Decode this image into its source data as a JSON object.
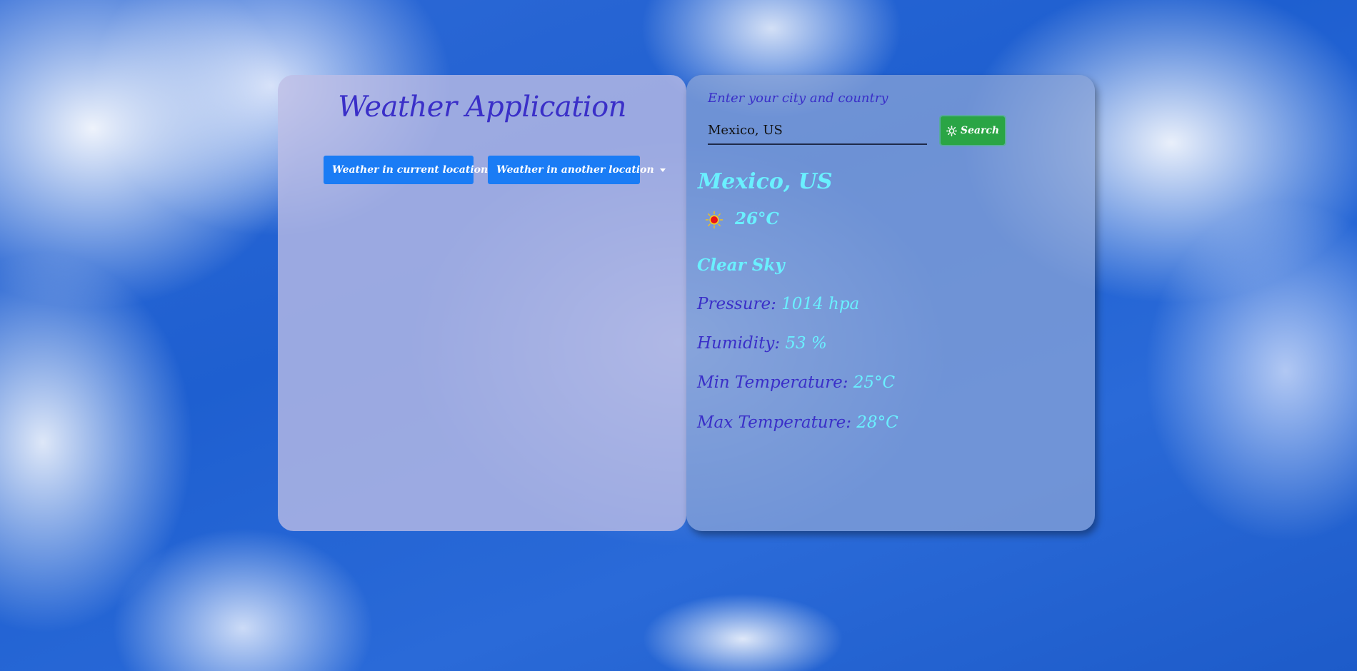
{
  "app": {
    "title": "Weather Application"
  },
  "location_menu": {
    "current_label": "Weather in current location",
    "another_label": "Weather in another location"
  },
  "search": {
    "label": "Enter your city and country",
    "value": "Mexico, US",
    "button_label": "Search",
    "button_icon": "sun-icon"
  },
  "weather": {
    "city": "Mexico, US",
    "icon": "sun-icon",
    "temperature": "26°C",
    "description": "Clear Sky",
    "pressure_label": "Pressure:",
    "pressure_value": "1014 hpa",
    "humidity_label": "Humidity:",
    "humidity_value": "53 %",
    "min_label": "Min Temperature:",
    "min_value": "25°C",
    "max_label": "Max Temperature:",
    "max_value": "28°C"
  },
  "colors": {
    "title": "#3a2fc8",
    "value_cyan": "#6af0ff",
    "primary_button": "#1a7cf5",
    "success_button": "#2aa545"
  }
}
